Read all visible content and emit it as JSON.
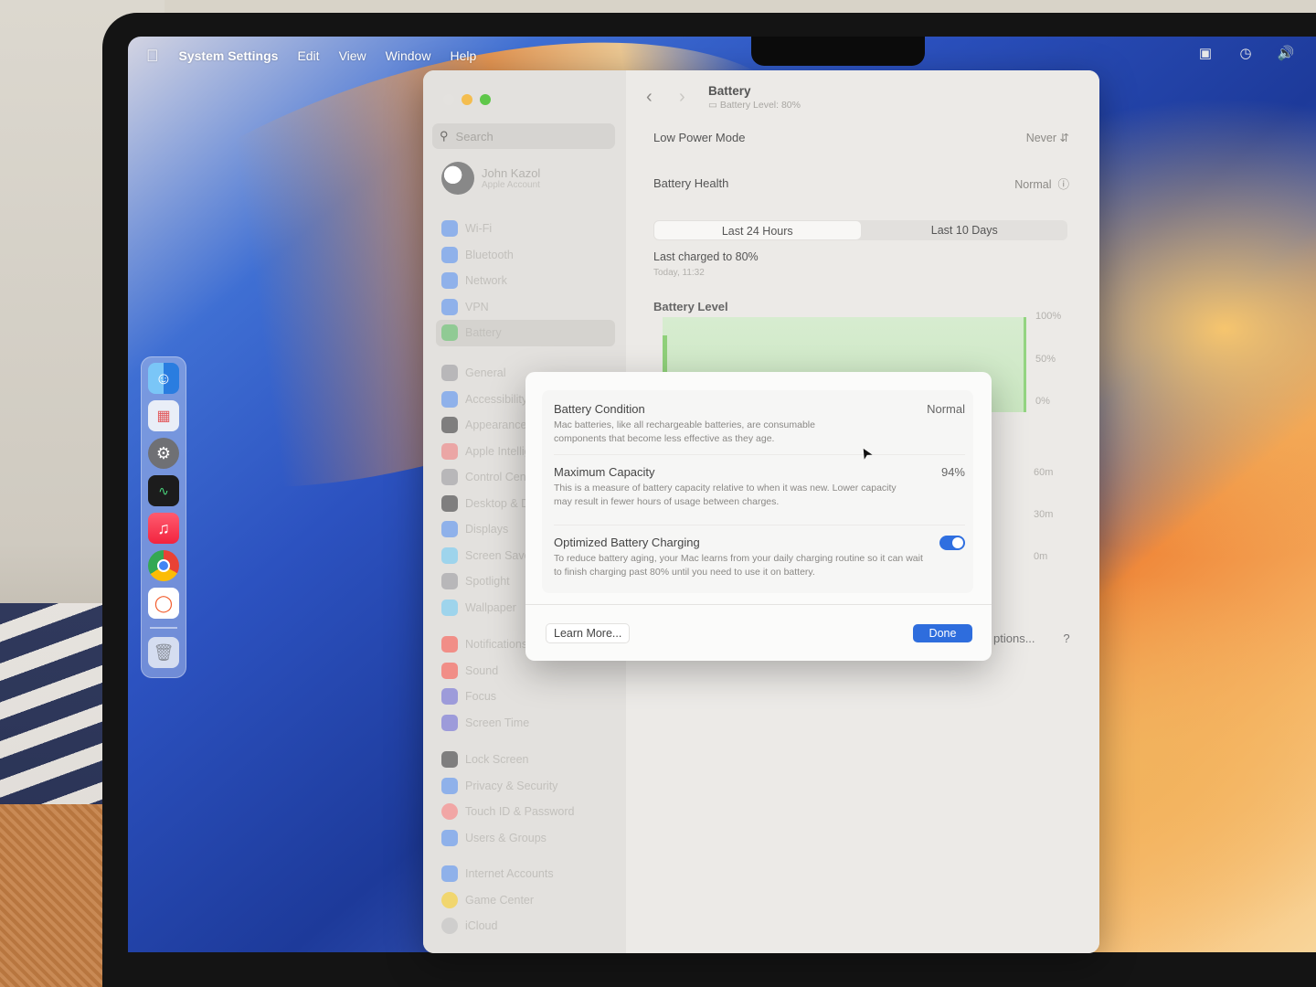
{
  "menubar": {
    "app_name": "System Settings",
    "items": [
      "Edit",
      "View",
      "Window",
      "Help"
    ],
    "apple_icon": "apple-icon",
    "status_icons": [
      "screen-mirroring-icon",
      "time-machine-icon",
      "volume-icon"
    ]
  },
  "dock": {
    "apps": [
      "finder",
      "launchpad",
      "system-settings",
      "activity-monitor",
      "music",
      "chrome",
      "brave",
      "trash"
    ]
  },
  "window": {
    "search": {
      "placeholder": "Search"
    },
    "profile": {
      "name": "John Kazol",
      "subtitle": "Apple Account"
    },
    "sidebar_group1": [
      "Wi-Fi",
      "Bluetooth",
      "Network",
      "VPN",
      "Battery"
    ],
    "sidebar_group2": [
      "General",
      "Accessibility",
      "Appearance",
      "Apple Intelligence",
      "Control Centre",
      "Desktop & Dock",
      "Displays",
      "Screen Saver",
      "Spotlight",
      "Wallpaper"
    ],
    "sidebar_group3": [
      "Notifications",
      "Sound",
      "Focus",
      "Screen Time"
    ],
    "sidebar_group4": [
      "Lock Screen",
      "Privacy & Security",
      "Touch ID & Password",
      "Users & Groups"
    ],
    "sidebar_group5": [
      "Internet Accounts",
      "Game Center",
      "iCloud"
    ],
    "pane": {
      "title": "Battery",
      "subtitle": "Battery Level: 80%",
      "low_power_label": "Low Power Mode",
      "low_power_value": "Never",
      "health_label": "Battery Health",
      "health_value": "Normal",
      "tabs": [
        "Last 24 Hours",
        "Last 10 Days"
      ],
      "last_charged": "Last charged to 80%",
      "last_charged_time": "Today, 11:32",
      "level_title": "Battery Level",
      "level_axis": [
        "100%",
        "50%",
        "0%"
      ],
      "usage_axis": [
        "60m",
        "30m",
        "0m"
      ],
      "options_label": "ptions...",
      "help_label": "?"
    }
  },
  "sheet": {
    "condition_title": "Battery Condition",
    "condition_value": "Normal",
    "condition_desc": "Mac batteries, like all rechargeable batteries, are consumable components that become less effective as they age.",
    "capacity_title": "Maximum Capacity",
    "capacity_value": "94%",
    "capacity_desc": "This is a measure of battery capacity relative to when it was new. Lower capacity may result in fewer hours of usage between charges.",
    "optimized_title": "Optimized Battery Charging",
    "optimized_on": true,
    "optimized_desc": "To reduce battery aging, your Mac learns from your daily charging routine so it can wait to finish charging past 80% until you need to use it on battery.",
    "learn_more": "Learn More...",
    "done": "Done"
  },
  "colors": {
    "accent": "#2e6ddd",
    "battery_green": "#93d481"
  }
}
